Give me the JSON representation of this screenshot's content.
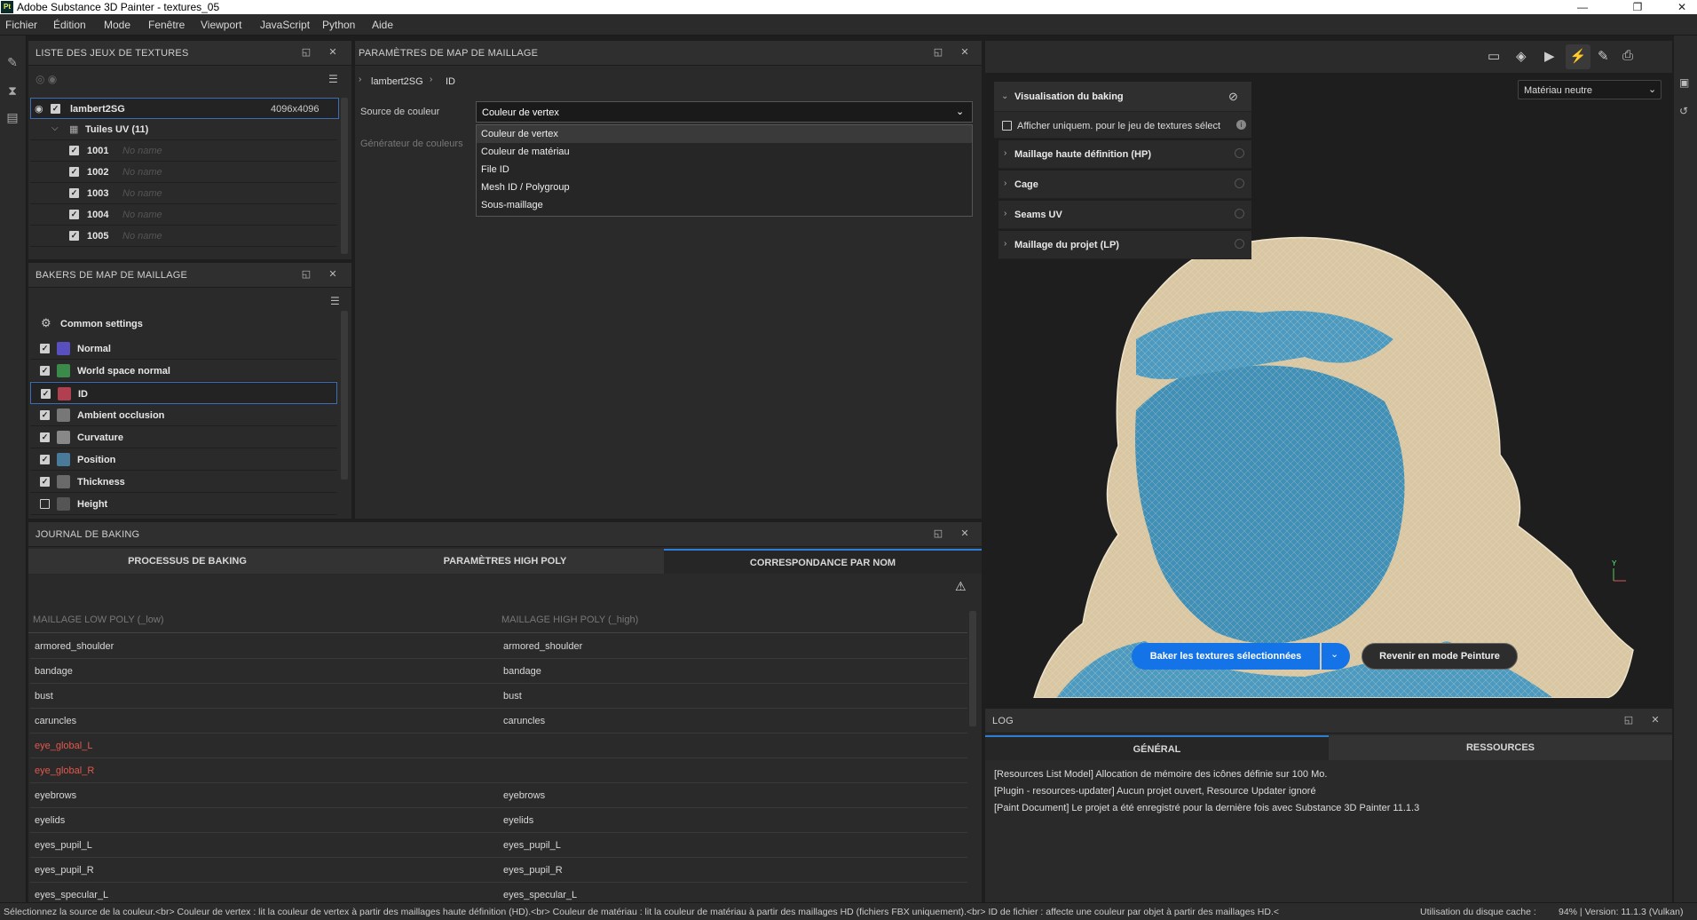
{
  "window": {
    "title": "Adobe Substance 3D Painter - textures_05",
    "logo": "Pt",
    "minimize": "—",
    "maximize": "❐",
    "close": "✕"
  },
  "menu": [
    "Fichier",
    "Édition",
    "Mode",
    "Fenêtre",
    "Viewport",
    "JavaScript",
    "Python",
    "Aide"
  ],
  "texture_sets": {
    "title": "LISTE DES JEUX DE TEXTURES",
    "set_name": "lambert2SG",
    "set_size": "4096x4096",
    "udim_group": "Tuiles UV (11)",
    "tiles": [
      {
        "id": "1001",
        "name": "No name"
      },
      {
        "id": "1002",
        "name": "No name"
      },
      {
        "id": "1003",
        "name": "No name"
      },
      {
        "id": "1004",
        "name": "No name"
      },
      {
        "id": "1005",
        "name": "No name"
      }
    ]
  },
  "bakers": {
    "title": "BAKERS DE MAP DE MAILLAGE",
    "common": "Common settings",
    "items": [
      {
        "label": "Normal",
        "checked": true,
        "color": "#5a4fbf"
      },
      {
        "label": "World space normal",
        "checked": true,
        "color": "#3a8a4a"
      },
      {
        "label": "ID",
        "checked": true,
        "color": "#b04050"
      },
      {
        "label": "Ambient occlusion",
        "checked": true,
        "color": "#777777"
      },
      {
        "label": "Curvature",
        "checked": true,
        "color": "#888888"
      },
      {
        "label": "Position",
        "checked": true,
        "color": "#4a7a9a"
      },
      {
        "label": "Thickness",
        "checked": true,
        "color": "#6a6a6a"
      },
      {
        "label": "Height",
        "checked": false,
        "color": "#555555"
      }
    ]
  },
  "params": {
    "title": "PARAMÈTRES DE MAP DE MAILLAGE",
    "crumb1": "lambert2SG",
    "crumb2": "ID",
    "source_label": "Source de couleur",
    "source_value": "Couleur de vertex",
    "generator_label": "Générateur de couleurs",
    "dropdown_options": [
      "Couleur de vertex",
      "Couleur de matériau",
      "File ID",
      "Mesh ID / Polygroup",
      "Sous-maillage"
    ]
  },
  "journal": {
    "title": "JOURNAL DE BAKING",
    "tabs": [
      "PROCESSUS DE BAKING",
      "PARAMÈTRES HIGH POLY",
      "CORRESPONDANCE PAR NOM"
    ],
    "warn": "⚠",
    "col_low": "MAILLAGE LOW POLY (_low)",
    "col_high": "MAILLAGE HIGH POLY (_high)",
    "rows": [
      {
        "low": "armored_shoulder",
        "high": "armored_shoulder"
      },
      {
        "low": "bandage",
        "high": "bandage"
      },
      {
        "low": "bust",
        "high": "bust"
      },
      {
        "low": "caruncles",
        "high": "caruncles"
      },
      {
        "low": "eye_global_L",
        "high": ""
      },
      {
        "low": "eye_global_R",
        "high": ""
      },
      {
        "low": "eyebrows",
        "high": "eyebrows"
      },
      {
        "low": "eyelids",
        "high": "eyelids"
      },
      {
        "low": "eyes_pupil_L",
        "high": "eyes_pupil_L"
      },
      {
        "low": "eyes_pupil_R",
        "high": "eyes_pupil_R"
      },
      {
        "low": "eyes_specular_L",
        "high": "eyes_specular_L"
      }
    ]
  },
  "viewport": {
    "material": "Matériau neutre",
    "bake_button": "Baker les textures sélectionnées",
    "paint_button": "Revenir en mode Peinture",
    "axis_y": "Y",
    "baking_vis": {
      "title": "Visualisation du baking",
      "checkbox": "Afficher uniquem. pour le jeu de textures sélect",
      "sections": [
        "Maillage haute définition (HP)",
        "Cage",
        "Seams UV",
        "Maillage du projet (LP)"
      ]
    }
  },
  "log": {
    "title": "LOG",
    "tabs": [
      "GÉNÉRAL",
      "RESSOURCES"
    ],
    "lines": [
      "[Resources List Model] Allocation de mémoire des icônes définie sur 100 Mo.",
      "[Plugin - resources-updater] Aucun projet ouvert, Resource Updater ignoré",
      "[Paint Document] Le projet a été enregistré pour la dernière fois avec Substance 3D Painter 11.1.3"
    ]
  },
  "status": {
    "help": "Sélectionnez la source de la couleur.<br> Couleur de vertex : lit la couleur de vertex à partir des maillages haute définition (HD).<br> Couleur de matériau : lit la couleur de matériau à partir des maillages HD (fichiers FBX uniquement).<br> ID de fichier : affecte une couleur par objet à partir des maillages HD.<",
    "cache": "Utilisation du disque cache :",
    "cache_val": "94% | Version: 11.1.3 (Vulkan)"
  }
}
